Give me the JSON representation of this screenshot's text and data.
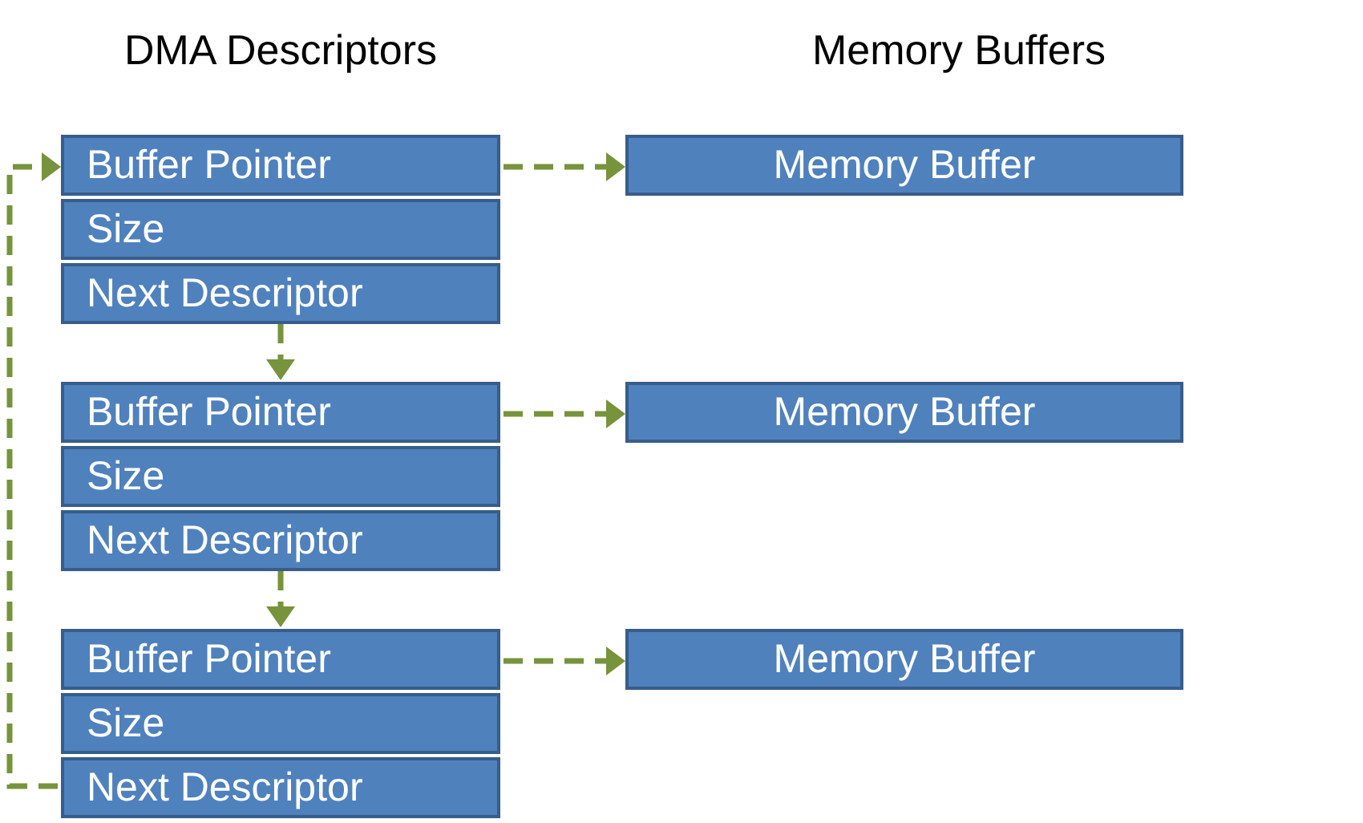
{
  "headings": [
    "DMA Descriptors",
    "Memory Buffers"
  ],
  "descriptors": [
    {
      "fields": [
        "Buffer Pointer",
        "Size",
        "Next Descriptor"
      ]
    },
    {
      "fields": [
        "Buffer Pointer",
        "Size",
        "Next Descriptor"
      ]
    },
    {
      "fields": [
        "Buffer Pointer",
        "Size",
        "Next Descriptor"
      ]
    }
  ],
  "buffers": [
    {
      "label": "Memory Buffer"
    },
    {
      "label": "Memory Buffer"
    },
    {
      "label": "Memory Buffer"
    }
  ]
}
